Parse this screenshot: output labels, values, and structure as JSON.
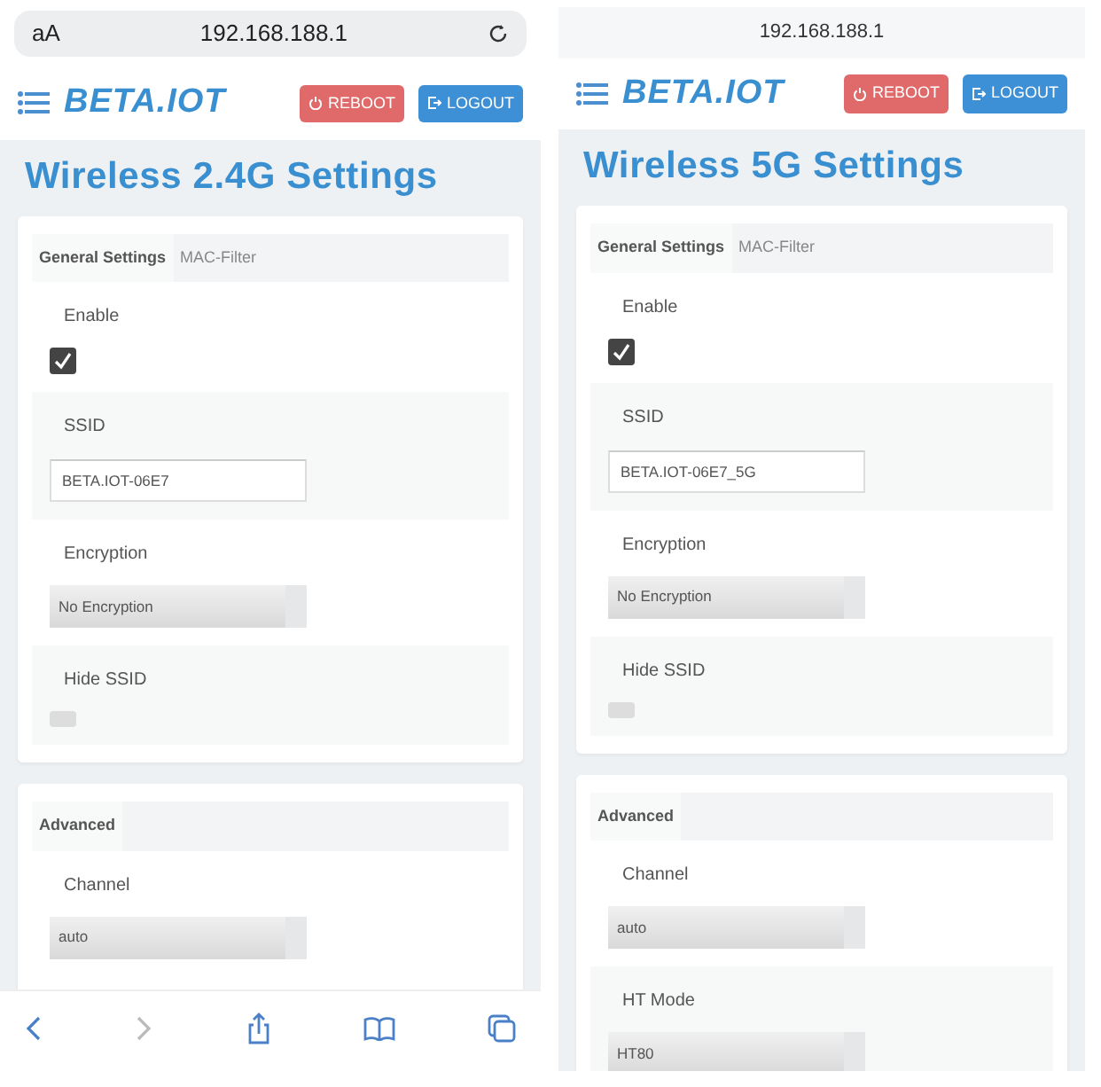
{
  "phones": [
    {
      "kind": "full",
      "browser": {
        "text_size": "aA",
        "url": "192.168.188.1"
      },
      "brand": "BETA.IOT",
      "buttons": [
        {
          "label": "REBOOT",
          "kind": "reboot"
        },
        {
          "label": "LOGOUT",
          "kind": "logout"
        }
      ],
      "title": "Wireless 2.4G Settings",
      "sections": [
        {
          "tabs": [
            {
              "label": "General Settings",
              "selected": true
            },
            {
              "label": "MAC-Filter",
              "selected": false
            }
          ],
          "fields": [
            {
              "kind": "checkbox",
              "label": "Enable",
              "checked": true
            },
            {
              "kind": "text",
              "label": "SSID",
              "value": "BETA.IOT-06E7"
            },
            {
              "kind": "select",
              "label": "Encryption",
              "value": "No Encryption"
            },
            {
              "kind": "checkbox",
              "label": "Hide SSID",
              "checked": false
            }
          ]
        },
        {
          "tabs": [
            {
              "label": "Advanced",
              "selected": true
            }
          ],
          "fields": [
            {
              "kind": "select",
              "label": "Channel",
              "value": "auto"
            }
          ]
        }
      ]
    },
    {
      "kind": "compact",
      "browser": {
        "url": "192.168.188.1"
      },
      "brand": "BETA.IOT",
      "buttons": [
        {
          "label": "REBOOT",
          "kind": "reboot"
        },
        {
          "label": "LOGOUT",
          "kind": "logout"
        }
      ],
      "title": "Wireless 5G Settings",
      "sections": [
        {
          "tabs": [
            {
              "label": "General Settings",
              "selected": true
            },
            {
              "label": "MAC-Filter",
              "selected": false
            }
          ],
          "fields": [
            {
              "kind": "checkbox",
              "label": "Enable",
              "checked": true
            },
            {
              "kind": "text",
              "label": "SSID",
              "value": "BETA.IOT-06E7_5G"
            },
            {
              "kind": "select",
              "label": "Encryption",
              "value": "No Encryption"
            },
            {
              "kind": "checkbox",
              "label": "Hide SSID",
              "checked": false
            }
          ]
        },
        {
          "tabs": [
            {
              "label": "Advanced",
              "selected": true
            }
          ],
          "fields": [
            {
              "kind": "select",
              "label": "Channel",
              "value": "auto"
            },
            {
              "kind": "select",
              "label": "HT Mode",
              "value": "HT80"
            }
          ]
        }
      ]
    }
  ]
}
